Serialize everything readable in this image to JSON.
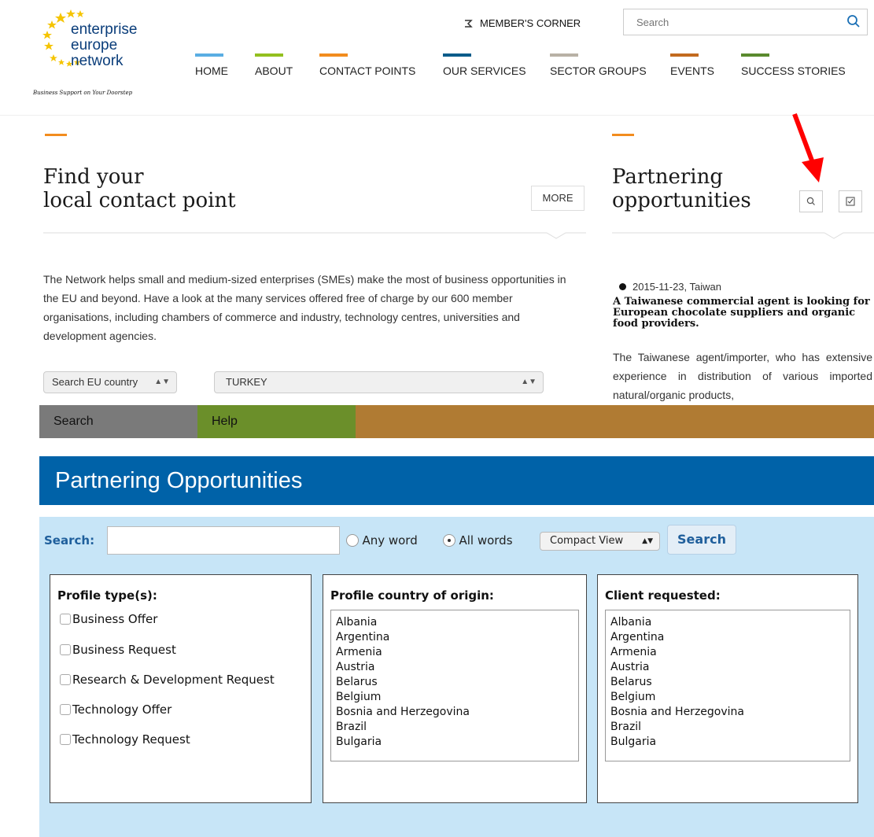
{
  "brand": {
    "line1": "enterprise",
    "line2": "europe",
    "line3": "network",
    "tagline": "Business Support on Your Doorstep"
  },
  "header": {
    "members_corner": "MEMBER'S CORNER",
    "search_placeholder": "Search"
  },
  "nav": [
    {
      "label": "HOME",
      "color": "#5aaee3"
    },
    {
      "label": "ABOUT",
      "color": "#93c01f"
    },
    {
      "label": "CONTACT POINTS",
      "color": "#f28c1e"
    },
    {
      "label": "OUR SERVICES",
      "color": "#0a5c8a"
    },
    {
      "label": "SECTOR GROUPS",
      "color": "#b8b1a5"
    },
    {
      "label": "EVENTS",
      "color": "#c26a1f"
    },
    {
      "label": "SUCCESS STORIES",
      "color": "#5a8a2e"
    }
  ],
  "contact": {
    "title_line1": "Find your",
    "title_line2": "local contact point",
    "more_label": "MORE",
    "paragraph": "The Network helps small and medium-sized enterprises (SMEs) make the most of business opportunities in the EU and beyond. Have a look at the many services offered free of charge by our 600 member organisations, including chambers of commerce and industry, technology centres, universities and development agencies.",
    "country_select": "Search EU country",
    "country_value": "TURKEY"
  },
  "partnering": {
    "title_line1": "Partnering",
    "title_line2": "opportunities",
    "date": "2015-11-23, Taiwan",
    "headline": "A Taiwanese commercial agent is looking for European chocolate suppliers and organic food providers.",
    "body": "The Taiwanese agent/importer, who has extensive experience in distribution of various imported natural/organic products,"
  },
  "tabs": [
    {
      "label": "Search",
      "color": "#7a7a7a"
    },
    {
      "label": "Help",
      "color": "#6b8f2a"
    },
    {
      "label": "",
      "color": "#b07b33"
    }
  ],
  "po": {
    "title": "Partnering Opportunities",
    "search_label": "Search:",
    "any_word": "Any word",
    "all_words": "All words",
    "view_select": "Compact View",
    "search_button": "Search",
    "profile_types_title": "Profile type(s):",
    "profile_types": [
      "Business Offer",
      "Business Request",
      "Research & Development Request",
      "Technology Offer",
      "Technology Request"
    ],
    "origin_title": "Profile country of origin:",
    "client_title": "Client requested:",
    "countries": [
      "Albania",
      "Argentina",
      "Armenia",
      "Austria",
      "Belarus",
      "Belgium",
      "Bosnia and Herzegovina",
      "Brazil",
      "Bulgaria"
    ]
  }
}
